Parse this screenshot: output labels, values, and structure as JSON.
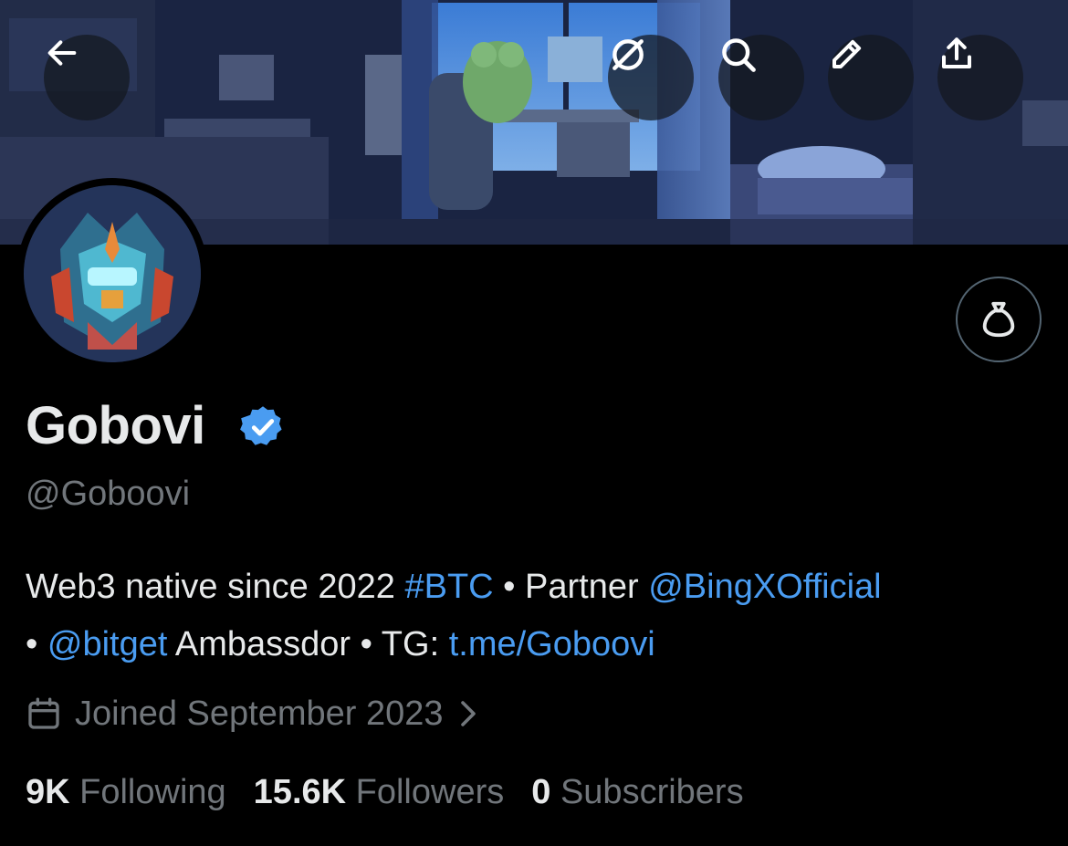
{
  "header": {
    "back_icon": "arrow-left-icon",
    "grok_icon": "grok-icon",
    "search_icon": "search-icon",
    "edit_icon": "pencil-icon",
    "share_icon": "share-icon"
  },
  "profile": {
    "display_name": "Gobovi",
    "verified": true,
    "handle": "@Goboovi",
    "bio": {
      "part1": "Web3 native since 2022 ",
      "hashtag": "#BTC",
      "part2": " • Partner ",
      "mention1": "@BingXOfficial",
      "part3": "• ",
      "mention2": "@bitget",
      "part4": " Ambassdor • TG: ",
      "link": "t.me/Goboovi"
    },
    "joined": "Joined September 2023",
    "tip_icon": "money-bag-icon"
  },
  "stats": {
    "following_count": "9K",
    "following_label": "Following",
    "followers_count": "15.6K",
    "followers_label": "Followers",
    "subscribers_count": "0",
    "subscribers_label": "Subscribers"
  },
  "colors": {
    "accent": "#4a9cf1",
    "muted": "#71767b",
    "text": "#e7e9ea",
    "background": "#000000"
  }
}
